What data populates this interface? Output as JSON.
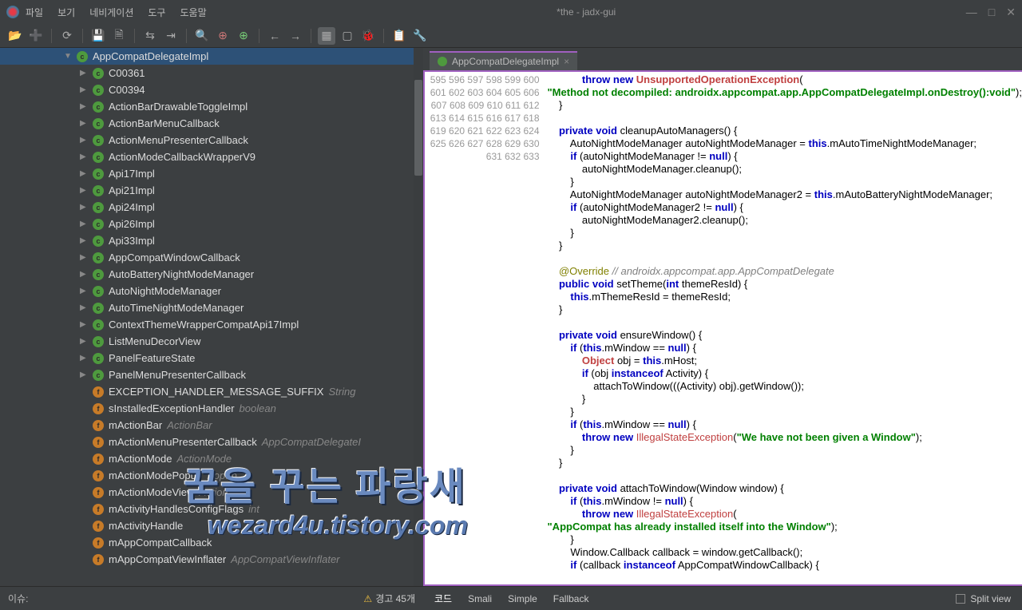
{
  "title": "*the - jadx-gui",
  "menu": [
    "파일",
    "보기",
    "네비게이션",
    "도구",
    "도움말"
  ],
  "tree": {
    "header": "AppCompatDelegateImpl",
    "items": [
      {
        "arrow": "▶",
        "icon": "c",
        "ic": "ic-class",
        "name": "C00361",
        "type": ""
      },
      {
        "arrow": "▶",
        "icon": "c",
        "ic": "ic-class",
        "name": "C00394",
        "type": ""
      },
      {
        "arrow": "▶",
        "icon": "c",
        "ic": "ic-class",
        "name": "ActionBarDrawableToggleImpl",
        "type": ""
      },
      {
        "arrow": "▶",
        "icon": "c",
        "ic": "ic-class",
        "name": "ActionBarMenuCallback",
        "type": ""
      },
      {
        "arrow": "▶",
        "icon": "c",
        "ic": "ic-class",
        "name": "ActionMenuPresenterCallback",
        "type": ""
      },
      {
        "arrow": "▶",
        "icon": "c",
        "ic": "ic-class",
        "name": "ActionModeCallbackWrapperV9",
        "type": ""
      },
      {
        "arrow": "▶",
        "icon": "c",
        "ic": "ic-class",
        "name": "Api17Impl",
        "type": ""
      },
      {
        "arrow": "▶",
        "icon": "c",
        "ic": "ic-class",
        "name": "Api21Impl",
        "type": ""
      },
      {
        "arrow": "▶",
        "icon": "c",
        "ic": "ic-class",
        "name": "Api24Impl",
        "type": ""
      },
      {
        "arrow": "▶",
        "icon": "c",
        "ic": "ic-class",
        "name": "Api26Impl",
        "type": ""
      },
      {
        "arrow": "▶",
        "icon": "c",
        "ic": "ic-class",
        "name": "Api33Impl",
        "type": ""
      },
      {
        "arrow": "▶",
        "icon": "c",
        "ic": "ic-class",
        "name": "AppCompatWindowCallback",
        "type": ""
      },
      {
        "arrow": "▶",
        "icon": "c",
        "ic": "ic-class",
        "name": "AutoBatteryNightModeManager",
        "type": ""
      },
      {
        "arrow": "▶",
        "icon": "c",
        "ic": "ic-class",
        "name": "AutoNightModeManager",
        "type": ""
      },
      {
        "arrow": "▶",
        "icon": "c",
        "ic": "ic-class",
        "name": "AutoTimeNightModeManager",
        "type": ""
      },
      {
        "arrow": "▶",
        "icon": "c",
        "ic": "ic-class",
        "name": "ContextThemeWrapperCompatApi17Impl",
        "type": ""
      },
      {
        "arrow": "▶",
        "icon": "c",
        "ic": "ic-class",
        "name": "ListMenuDecorView",
        "type": ""
      },
      {
        "arrow": "▶",
        "icon": "c",
        "ic": "ic-class",
        "name": "PanelFeatureState",
        "type": ""
      },
      {
        "arrow": "▶",
        "icon": "c",
        "ic": "ic-class",
        "name": "PanelMenuPresenterCallback",
        "type": ""
      },
      {
        "arrow": "",
        "icon": "f",
        "ic": "ic-field",
        "name": "EXCEPTION_HANDLER_MESSAGE_SUFFIX",
        "type": "String"
      },
      {
        "arrow": "",
        "icon": "f",
        "ic": "ic-field",
        "name": "sInstalledExceptionHandler",
        "type": "boolean"
      },
      {
        "arrow": "",
        "icon": "f",
        "ic": "ic-field",
        "name": "mActionBar",
        "type": "ActionBar"
      },
      {
        "arrow": "",
        "icon": "f",
        "ic": "ic-field",
        "name": "mActionMenuPresenterCallback",
        "type": "AppCompatDelegateI"
      },
      {
        "arrow": "",
        "icon": "f",
        "ic": "ic-field",
        "name": "mActionMode",
        "type": "ActionMode"
      },
      {
        "arrow": "",
        "icon": "f",
        "ic": "ic-field",
        "name": "mActionModePopup",
        "type": "Popup"
      },
      {
        "arrow": "",
        "icon": "f",
        "ic": "ic-field",
        "name": "mActionModeView",
        "type": "Action"
      },
      {
        "arrow": "",
        "icon": "f",
        "ic": "ic-field",
        "name": "mActivityHandlesConfigFlags",
        "type": "int"
      },
      {
        "arrow": "",
        "icon": "f",
        "ic": "ic-field",
        "name": "mActivityHandle",
        "type": ""
      },
      {
        "arrow": "",
        "icon": "f",
        "ic": "ic-field",
        "name": "mAppCompatCallback",
        "type": ""
      },
      {
        "arrow": "",
        "icon": "f",
        "ic": "ic-field",
        "name": "mAppCompatViewInflater",
        "type": "AppCompatViewInflater"
      }
    ]
  },
  "tab": {
    "name": "AppCompatDelegateImpl"
  },
  "code": {
    "start": 595,
    "lines": [
      "            <span class='kw'>throw</span> <span class='kw'>new</span> <span class='err'>UnsupportedOperationException</span>(",
      "<span class='str'>\"Method not decompiled: androidx.appcompat.app.AppCompatDelegateImpl.onDestroy():void\"</span>);",
      "    }",
      "",
      "    <span class='kw'>private</span> <span class='kw'>void</span> cleanupAutoManagers() {",
      "        AutoNightModeManager autoNightModeManager = <span class='kw'>this</span>.mAutoTimeNightModeManager;",
      "        <span class='kw'>if</span> (autoNightModeManager != <span class='kw'>null</span>) {",
      "            autoNightModeManager.cleanup();",
      "        }",
      "        AutoNightModeManager autoNightModeManager2 = <span class='kw'>this</span>.mAutoBatteryNightModeManager;",
      "        <span class='kw'>if</span> (autoNightModeManager2 != <span class='kw'>null</span>) {",
      "            autoNightModeManager2.cleanup();",
      "        }",
      "    }",
      "",
      "    <span class='ann'>@Override</span> <span class='cmt'>// androidx.appcompat.app.AppCompatDelegate</span>",
      "    <span class='kw'>public</span> <span class='kw'>void</span> setTheme(<span class='kw'>int</span> themeResId) {",
      "        <span class='kw'>this</span>.mThemeResId = themeResId;",
      "    }",
      "",
      "    <span class='kw'>private</span> <span class='kw'>void</span> ensureWindow() {",
      "        <span class='kw'>if</span> (<span class='kw'>this</span>.mWindow == <span class='kw'>null</span>) {",
      "            <span class='err'>Object</span> obj = <span class='kw'>this</span>.mHost;",
      "            <span class='kw'>if</span> (obj <span class='kw'>instanceof</span> Activity) {",
      "                attachToWindow(((Activity) obj).getWindow());",
      "            }",
      "        }",
      "        <span class='kw'>if</span> (<span class='kw'>this</span>.mWindow == <span class='kw'>null</span>) {",
      "            <span class='kw'>throw</span> <span class='kw'>new</span> <span class='ill'>IllegalStateException</span>(<span class='str'>\"We have not been given a Window\"</span>);",
      "        }",
      "    }",
      "",
      "    <span class='kw'>private</span> <span class='kw'>void</span> attachToWindow(Window window) {",
      "        <span class='kw'>if</span> (<span class='kw'>this</span>.mWindow != <span class='kw'>null</span>) {",
      "            <span class='kw'>throw</span> <span class='kw'>new</span> <span class='ill'>IllegalStateException</span>(",
      "<span class='str'>\"AppCompat has already installed itself into the Window\"</span>);",
      "        }",
      "        Window.Callback callback = window.getCallback();",
      "        <span class='kw'>if</span> (callback <span class='kw'>instanceof</span> AppCompatWindowCallback) {"
    ]
  },
  "footer": {
    "issue": "이슈:",
    "warn": "경고 45개",
    "modes": [
      "코드",
      "Smali",
      "Simple",
      "Fallback"
    ],
    "split": "Split view"
  },
  "watermark1": "꿈을 꾸는 파랑새",
  "watermark2": "wezard4u.tistory.com"
}
